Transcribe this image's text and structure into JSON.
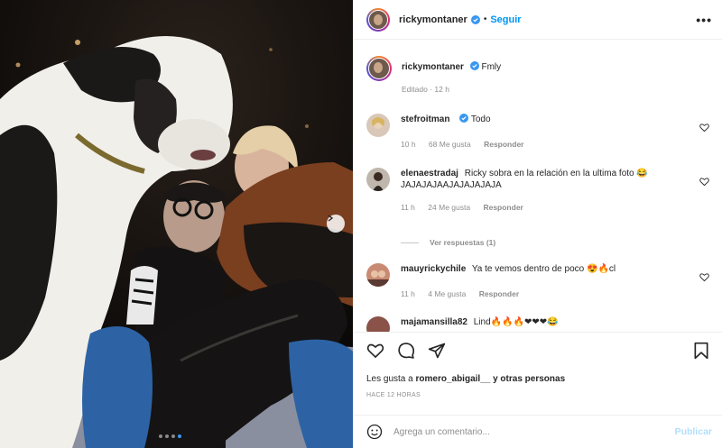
{
  "header": {
    "username": "rickymontaner",
    "separator": "•",
    "follow_label": "Seguir",
    "more_label": "•••"
  },
  "caption": {
    "username": "rickymontaner",
    "text": "Fmly",
    "meta": "Editado · 12 h"
  },
  "comments": [
    {
      "username": "stefroitman",
      "verified": true,
      "text": "Todo",
      "time": "10 h",
      "likes": "68 Me gusta",
      "reply": "Responder"
    },
    {
      "username": "elenaestradaj",
      "verified": false,
      "text": "Ricky sobra en la relación en la ultima foto 😂 JAJAJAJAAJAJAJAJAJA",
      "time": "11 h",
      "likes": "24 Me gusta",
      "reply": "Responder"
    },
    {
      "username": "mauyrickychile",
      "verified": false,
      "text": "Ya te vemos dentro de poco 😍🔥cl",
      "time": "11 h",
      "likes": "4 Me gusta",
      "reply": "Responder"
    },
    {
      "username": "majamansilla82",
      "verified": false,
      "text": "Lind🔥🔥🔥❤❤❤😂"
    }
  ],
  "view_replies": "Ver respuestas (1)",
  "likes": {
    "prefix": "Les gusta a",
    "user": "romero_abigail__",
    "suffix": "y otras personas"
  },
  "time_ago": "HACE 12 HORAS",
  "add_comment": {
    "placeholder": "Agrega un comentario...",
    "publish_label": "Publicar"
  },
  "carousel": {
    "slides": 4,
    "active_index": 3
  },
  "icons": [
    "heart-icon",
    "comment-icon",
    "share-icon",
    "bookmark-icon",
    "emoji-icon",
    "verified-icon",
    "more-icon",
    "chevron-right-icon"
  ],
  "colors": {
    "accent": "#0095f6",
    "publish_disabled": "#b2dffc",
    "muted": "#8e8e8e",
    "text": "#262626",
    "verified": "#3897f0"
  }
}
